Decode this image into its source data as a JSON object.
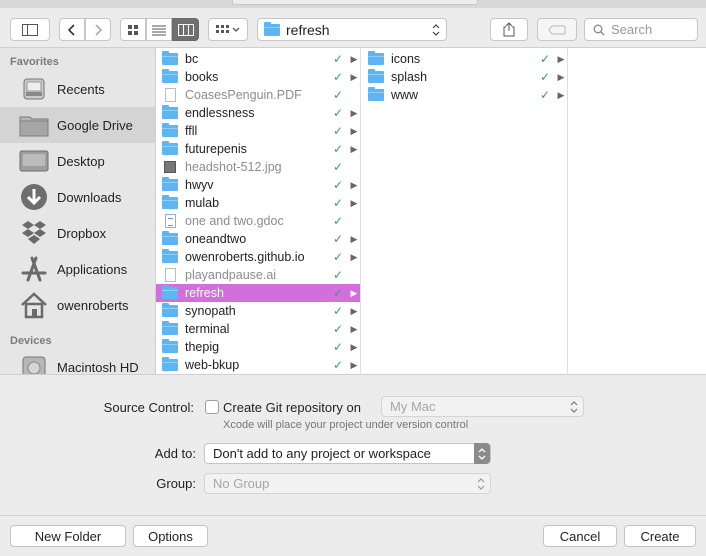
{
  "toolbar": {
    "path_label": "refresh",
    "search_placeholder": "Search"
  },
  "sidebar": {
    "favorites_heading": "Favorites",
    "devices_heading": "Devices",
    "items": [
      {
        "label": "Recents",
        "icon": "recents-icon"
      },
      {
        "label": "Google Drive",
        "icon": "folder-icon"
      },
      {
        "label": "Desktop",
        "icon": "desktop-icon"
      },
      {
        "label": "Downloads",
        "icon": "downloads-icon"
      },
      {
        "label": "Dropbox",
        "icon": "dropbox-icon"
      },
      {
        "label": "Applications",
        "icon": "applications-icon"
      },
      {
        "label": "owenroberts",
        "icon": "home-icon"
      }
    ],
    "devices": [
      {
        "label": "Macintosh HD",
        "icon": "hard-drive-icon"
      }
    ]
  },
  "column1": [
    {
      "name": "bc",
      "kind": "folder"
    },
    {
      "name": "books",
      "kind": "folder"
    },
    {
      "name": "CoasesPenguin.PDF",
      "kind": "file"
    },
    {
      "name": "endlessness",
      "kind": "folder"
    },
    {
      "name": "ffll",
      "kind": "folder"
    },
    {
      "name": "futurepenis",
      "kind": "folder"
    },
    {
      "name": "headshot-512.jpg",
      "kind": "image"
    },
    {
      "name": "hwyv",
      "kind": "folder"
    },
    {
      "name": "mulab",
      "kind": "folder"
    },
    {
      "name": "one and two.gdoc",
      "kind": "gdoc"
    },
    {
      "name": "oneandtwo",
      "kind": "folder"
    },
    {
      "name": "owenroberts.github.io",
      "kind": "folder"
    },
    {
      "name": "playandpause.ai",
      "kind": "file"
    },
    {
      "name": "refresh",
      "kind": "folder"
    },
    {
      "name": "synopath",
      "kind": "folder"
    },
    {
      "name": "terminal",
      "kind": "folder"
    },
    {
      "name": "thepig",
      "kind": "folder"
    },
    {
      "name": "web-bkup",
      "kind": "folder"
    }
  ],
  "column2": [
    {
      "name": "icons",
      "kind": "folder"
    },
    {
      "name": "splash",
      "kind": "folder"
    },
    {
      "name": "www",
      "kind": "folder"
    }
  ],
  "sync_check": "✓",
  "expand_arrow": "▶",
  "form": {
    "source_control_label": "Source Control:",
    "create_git_label": "Create Git repository on",
    "git_location": "My Mac",
    "git_note": "Xcode will place your project under version control",
    "add_to_label": "Add to:",
    "add_to_value": "Don't add to any project or workspace",
    "group_label": "Group:",
    "group_value": "No Group"
  },
  "buttons": {
    "new_folder": "New Folder",
    "options": "Options",
    "cancel": "Cancel",
    "create": "Create"
  },
  "colors": {
    "selection": "#d36fdc",
    "folder": "#5db6f2",
    "sync_check": "#3c9a5f"
  }
}
